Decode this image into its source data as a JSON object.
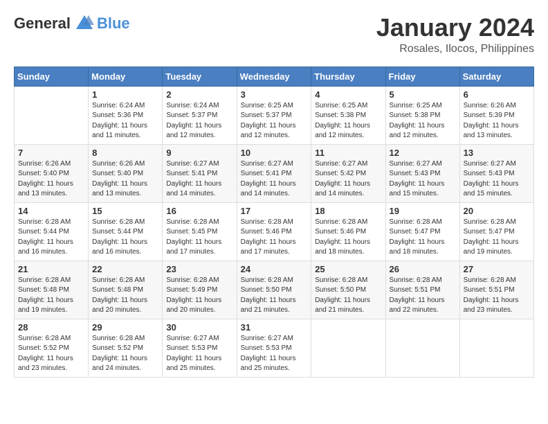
{
  "header": {
    "logo_general": "General",
    "logo_blue": "Blue",
    "month_year": "January 2024",
    "location": "Rosales, Ilocos, Philippines"
  },
  "days_of_week": [
    "Sunday",
    "Monday",
    "Tuesday",
    "Wednesday",
    "Thursday",
    "Friday",
    "Saturday"
  ],
  "weeks": [
    [
      {
        "day": "",
        "sunrise": "",
        "sunset": "",
        "daylight": ""
      },
      {
        "day": "1",
        "sunrise": "Sunrise: 6:24 AM",
        "sunset": "Sunset: 5:36 PM",
        "daylight": "Daylight: 11 hours and 11 minutes."
      },
      {
        "day": "2",
        "sunrise": "Sunrise: 6:24 AM",
        "sunset": "Sunset: 5:37 PM",
        "daylight": "Daylight: 11 hours and 12 minutes."
      },
      {
        "day": "3",
        "sunrise": "Sunrise: 6:25 AM",
        "sunset": "Sunset: 5:37 PM",
        "daylight": "Daylight: 11 hours and 12 minutes."
      },
      {
        "day": "4",
        "sunrise": "Sunrise: 6:25 AM",
        "sunset": "Sunset: 5:38 PM",
        "daylight": "Daylight: 11 hours and 12 minutes."
      },
      {
        "day": "5",
        "sunrise": "Sunrise: 6:25 AM",
        "sunset": "Sunset: 5:38 PM",
        "daylight": "Daylight: 11 hours and 12 minutes."
      },
      {
        "day": "6",
        "sunrise": "Sunrise: 6:26 AM",
        "sunset": "Sunset: 5:39 PM",
        "daylight": "Daylight: 11 hours and 13 minutes."
      }
    ],
    [
      {
        "day": "7",
        "sunrise": "Sunrise: 6:26 AM",
        "sunset": "Sunset: 5:40 PM",
        "daylight": "Daylight: 11 hours and 13 minutes."
      },
      {
        "day": "8",
        "sunrise": "Sunrise: 6:26 AM",
        "sunset": "Sunset: 5:40 PM",
        "daylight": "Daylight: 11 hours and 13 minutes."
      },
      {
        "day": "9",
        "sunrise": "Sunrise: 6:27 AM",
        "sunset": "Sunset: 5:41 PM",
        "daylight": "Daylight: 11 hours and 14 minutes."
      },
      {
        "day": "10",
        "sunrise": "Sunrise: 6:27 AM",
        "sunset": "Sunset: 5:41 PM",
        "daylight": "Daylight: 11 hours and 14 minutes."
      },
      {
        "day": "11",
        "sunrise": "Sunrise: 6:27 AM",
        "sunset": "Sunset: 5:42 PM",
        "daylight": "Daylight: 11 hours and 14 minutes."
      },
      {
        "day": "12",
        "sunrise": "Sunrise: 6:27 AM",
        "sunset": "Sunset: 5:43 PM",
        "daylight": "Daylight: 11 hours and 15 minutes."
      },
      {
        "day": "13",
        "sunrise": "Sunrise: 6:27 AM",
        "sunset": "Sunset: 5:43 PM",
        "daylight": "Daylight: 11 hours and 15 minutes."
      }
    ],
    [
      {
        "day": "14",
        "sunrise": "Sunrise: 6:28 AM",
        "sunset": "Sunset: 5:44 PM",
        "daylight": "Daylight: 11 hours and 16 minutes."
      },
      {
        "day": "15",
        "sunrise": "Sunrise: 6:28 AM",
        "sunset": "Sunset: 5:44 PM",
        "daylight": "Daylight: 11 hours and 16 minutes."
      },
      {
        "day": "16",
        "sunrise": "Sunrise: 6:28 AM",
        "sunset": "Sunset: 5:45 PM",
        "daylight": "Daylight: 11 hours and 17 minutes."
      },
      {
        "day": "17",
        "sunrise": "Sunrise: 6:28 AM",
        "sunset": "Sunset: 5:46 PM",
        "daylight": "Daylight: 11 hours and 17 minutes."
      },
      {
        "day": "18",
        "sunrise": "Sunrise: 6:28 AM",
        "sunset": "Sunset: 5:46 PM",
        "daylight": "Daylight: 11 hours and 18 minutes."
      },
      {
        "day": "19",
        "sunrise": "Sunrise: 6:28 AM",
        "sunset": "Sunset: 5:47 PM",
        "daylight": "Daylight: 11 hours and 18 minutes."
      },
      {
        "day": "20",
        "sunrise": "Sunrise: 6:28 AM",
        "sunset": "Sunset: 5:47 PM",
        "daylight": "Daylight: 11 hours and 19 minutes."
      }
    ],
    [
      {
        "day": "21",
        "sunrise": "Sunrise: 6:28 AM",
        "sunset": "Sunset: 5:48 PM",
        "daylight": "Daylight: 11 hours and 19 minutes."
      },
      {
        "day": "22",
        "sunrise": "Sunrise: 6:28 AM",
        "sunset": "Sunset: 5:48 PM",
        "daylight": "Daylight: 11 hours and 20 minutes."
      },
      {
        "day": "23",
        "sunrise": "Sunrise: 6:28 AM",
        "sunset": "Sunset: 5:49 PM",
        "daylight": "Daylight: 11 hours and 20 minutes."
      },
      {
        "day": "24",
        "sunrise": "Sunrise: 6:28 AM",
        "sunset": "Sunset: 5:50 PM",
        "daylight": "Daylight: 11 hours and 21 minutes."
      },
      {
        "day": "25",
        "sunrise": "Sunrise: 6:28 AM",
        "sunset": "Sunset: 5:50 PM",
        "daylight": "Daylight: 11 hours and 21 minutes."
      },
      {
        "day": "26",
        "sunrise": "Sunrise: 6:28 AM",
        "sunset": "Sunset: 5:51 PM",
        "daylight": "Daylight: 11 hours and 22 minutes."
      },
      {
        "day": "27",
        "sunrise": "Sunrise: 6:28 AM",
        "sunset": "Sunset: 5:51 PM",
        "daylight": "Daylight: 11 hours and 23 minutes."
      }
    ],
    [
      {
        "day": "28",
        "sunrise": "Sunrise: 6:28 AM",
        "sunset": "Sunset: 5:52 PM",
        "daylight": "Daylight: 11 hours and 23 minutes."
      },
      {
        "day": "29",
        "sunrise": "Sunrise: 6:28 AM",
        "sunset": "Sunset: 5:52 PM",
        "daylight": "Daylight: 11 hours and 24 minutes."
      },
      {
        "day": "30",
        "sunrise": "Sunrise: 6:27 AM",
        "sunset": "Sunset: 5:53 PM",
        "daylight": "Daylight: 11 hours and 25 minutes."
      },
      {
        "day": "31",
        "sunrise": "Sunrise: 6:27 AM",
        "sunset": "Sunset: 5:53 PM",
        "daylight": "Daylight: 11 hours and 25 minutes."
      },
      {
        "day": "",
        "sunrise": "",
        "sunset": "",
        "daylight": ""
      },
      {
        "day": "",
        "sunrise": "",
        "sunset": "",
        "daylight": ""
      },
      {
        "day": "",
        "sunrise": "",
        "sunset": "",
        "daylight": ""
      }
    ]
  ]
}
